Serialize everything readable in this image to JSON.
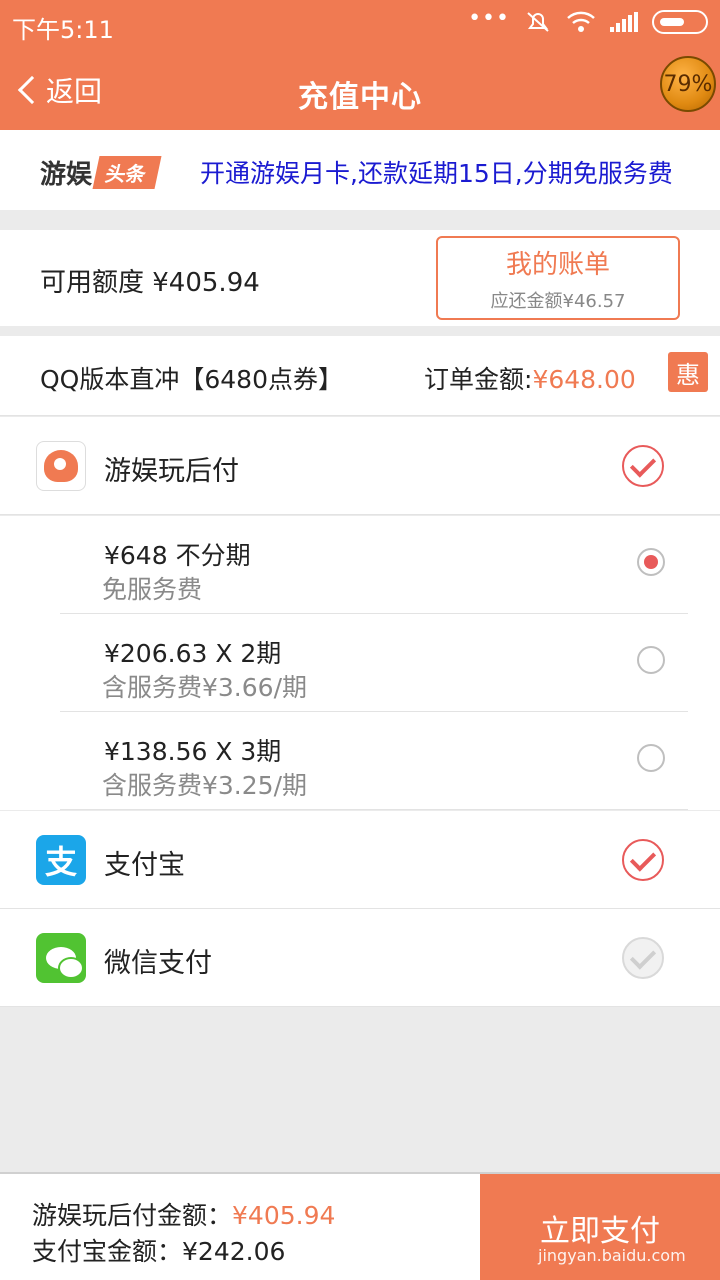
{
  "status": {
    "time": "下午5:11",
    "dots": "•••"
  },
  "header": {
    "back_label": "返回",
    "title": "充值中心",
    "badge": "79%"
  },
  "news": {
    "logo_main": "游娱",
    "logo_tag": "头条",
    "text": "开通游娱月卡,还款延期15日,分期免服务费"
  },
  "credit": {
    "label": "可用额度 ¥405.94",
    "bill_title": "我的账单",
    "bill_due": "应还金额¥46.57"
  },
  "order": {
    "name": "QQ版本直冲【6480点券】",
    "amount_label": "订单金额:",
    "amount_value": "¥648.00",
    "promo": "惠"
  },
  "methods": [
    {
      "label": "游娱玩后付",
      "checked": true
    },
    {
      "label": "支付宝",
      "checked": true,
      "icon_char": "支"
    },
    {
      "label": "微信支付",
      "checked": false
    }
  ],
  "installments": [
    {
      "main": "¥648 不分期",
      "sub": "免服务费",
      "selected": true
    },
    {
      "main": "¥206.63 X 2期",
      "sub": "含服务费¥3.66/期",
      "selected": false
    },
    {
      "main": "¥138.56 X 3期",
      "sub": "含服务费¥3.25/期",
      "selected": false
    }
  ],
  "summary": {
    "after_pay_label": "游娱玩后付金额：",
    "after_pay_value": "¥405.94",
    "alipay_label": "支付宝金额：",
    "alipay_value": "¥242.06",
    "pay_button": "立即支付"
  },
  "watermark": "jingyan.baidu.com",
  "colors": {
    "accent": "#f07a52",
    "link": "#1b1bd1",
    "check": "#e85a5a"
  }
}
